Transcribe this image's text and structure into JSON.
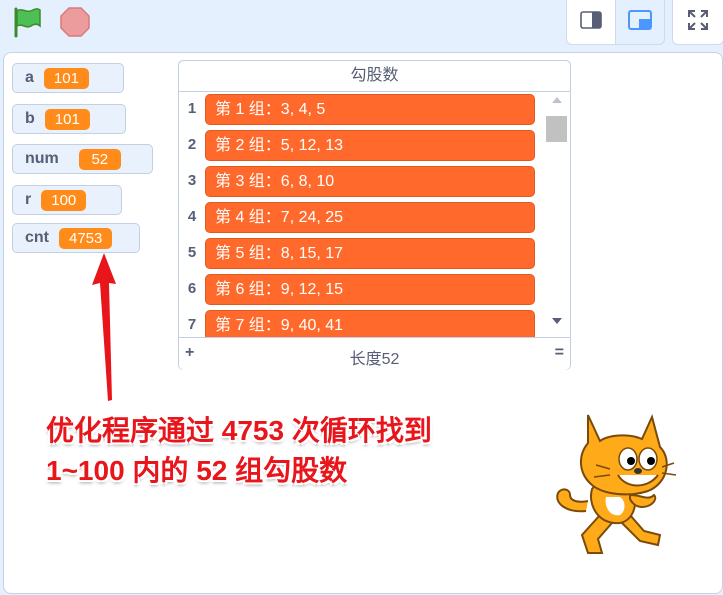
{
  "toolbar": {
    "green_flag_icon": "green-flag-icon",
    "stop_icon": "stop-sign-icon",
    "small_stage_icon": "small-stage-icon",
    "normal_stage_icon": "normal-stage-icon",
    "fullscreen_icon": "fullscreen-icon"
  },
  "monitors": [
    {
      "name": "a",
      "value": "101"
    },
    {
      "name": "b",
      "value": "101"
    },
    {
      "name": "num",
      "value": "52"
    },
    {
      "name": "r",
      "value": "100"
    },
    {
      "name": "cnt",
      "value": "4753"
    }
  ],
  "list": {
    "title": "勾股数",
    "items": [
      {
        "index": "1",
        "value": "第 1 组：3, 4, 5"
      },
      {
        "index": "2",
        "value": "第 2 组：5, 12, 13"
      },
      {
        "index": "3",
        "value": "第 3 组：6, 8, 10"
      },
      {
        "index": "4",
        "value": "第 4 组：7, 24, 25"
      },
      {
        "index": "5",
        "value": "第 5 组：8, 15, 17"
      },
      {
        "index": "6",
        "value": "第 6 组：9, 12, 15"
      },
      {
        "index": "7",
        "value": "第 7 组：9, 40, 41"
      }
    ],
    "add_label": "+",
    "length_label": "长度52",
    "resize_label": "="
  },
  "annotation": {
    "line1": "优化程序通过 4753 次循环找到",
    "line2": "1~100 内的 52 组勾股数"
  },
  "colors": {
    "accent_blue": "#4c97ff",
    "monitor_orange": "#ff8c1a",
    "list_item_orange": "#ff6a2c",
    "caption_red": "#e8151b"
  }
}
